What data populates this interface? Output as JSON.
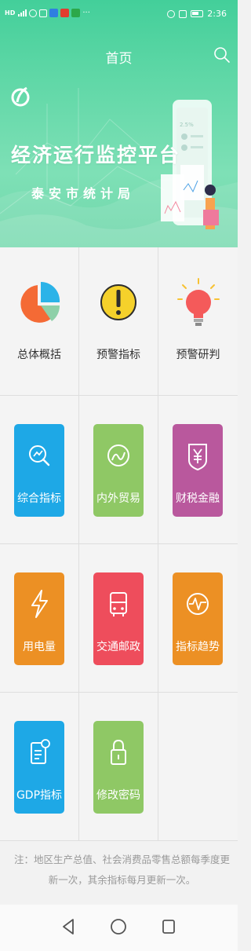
{
  "status_bar": {
    "time": "2:36"
  },
  "header": {
    "title": "首页"
  },
  "banner": {
    "title": "经济运行监控平台",
    "subtitle": "泰安市统计局",
    "phone_text": "2.5%"
  },
  "menu": {
    "items": [
      {
        "label": "总体概括",
        "icon": "pie-chart-icon"
      },
      {
        "label": "预警指标",
        "icon": "warning-icon"
      },
      {
        "label": "预警研判",
        "icon": "lightbulb-icon"
      },
      {
        "label": "综合指标",
        "icon": "search-chart-icon",
        "color": "#1ea8e6"
      },
      {
        "label": "内外贸易",
        "icon": "trade-icon",
        "color": "#8fc865"
      },
      {
        "label": "财税金融",
        "icon": "finance-icon",
        "color": "#b9589d"
      },
      {
        "label": "用电量",
        "icon": "electricity-icon",
        "color": "#ec9024"
      },
      {
        "label": "交通邮政",
        "icon": "bus-icon",
        "color": "#ee4d5c"
      },
      {
        "label": "指标趋势",
        "icon": "trend-icon",
        "color": "#ec9024"
      },
      {
        "label": "GDP指标",
        "icon": "gdp-document-icon",
        "color": "#1ea8e6"
      },
      {
        "label": "修改密码",
        "icon": "lock-icon",
        "color": "#8fc865"
      }
    ]
  },
  "note": "注：地区生产总值、社会消费品零售总额每季度更新一次，其余指标每月更新一次。",
  "colors": {
    "header_green": "#4fd39f",
    "tile_blue": "#1ea8e6",
    "tile_green": "#8fc865",
    "tile_purple": "#b9589d",
    "tile_orange": "#ec9024",
    "tile_red": "#ee4d5c"
  }
}
